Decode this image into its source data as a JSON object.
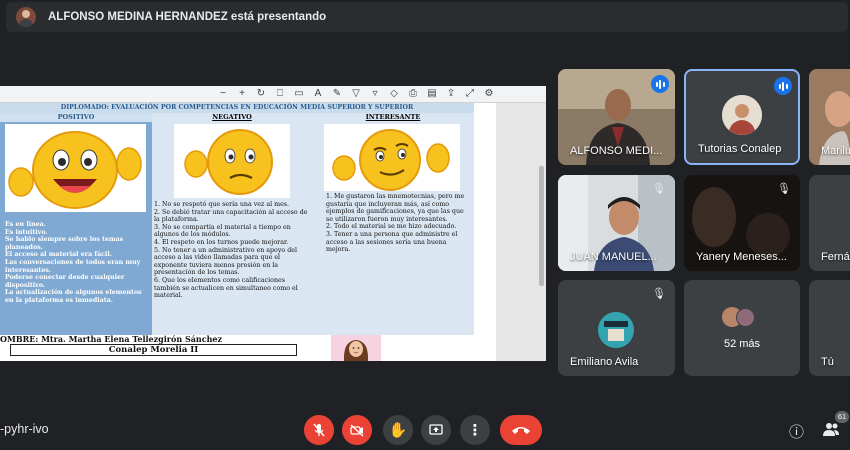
{
  "presenter": {
    "text": "ALFONSO MEDINA HERNANDEZ está presentando"
  },
  "document": {
    "header": "DIPLOMADO: EVALUACIÓN POR COMPETENCIAS EN EDUCACIÓN MEDIA SUPERIOR Y SUPERIOR",
    "columns": {
      "positive": {
        "title": "POSITIVO",
        "items": [
          "Es en línea.",
          "Es intuitivo.",
          "Se hablo siempre sobre los temas planeados.",
          "El acceso al material era fácil.",
          "Las conversaciones de todos eran muy interesantes.",
          "Poderse conectar desde cualquier dispositivo.",
          "La actualización de algunos elementos en la plataforma es inmediata."
        ]
      },
      "negative": {
        "title": "NEGATIVO",
        "items": [
          "1.  No se respetó que sería una vez al mes.",
          "2.  Se debió tratar una capacitación al acceso de la plataforma.",
          "3.  No se compartía el material a tiempo en algunos de los módulos.",
          "4.  El respeto en los turnos puede mejorar.",
          "5.  No tener a un administrativo en apoyo del acceso a las video llamadas para que el exponente tuviera menos presión en la presentación de los temas.",
          "6.  Que los elementos como calificaciones también se actualicen en simultaneo como el material."
        ]
      },
      "interesting": {
        "title": "INTERESANTE",
        "items": [
          "1.  Me gustaron las mnemotecnias, pero me gustaría que incluyeran más, así como ejemplos de gamificaciones, ya que las que se utilizaron fueron muy interesantes.",
          "2.  Todo el material se me hizo adecuado.",
          "3.  Tener a una persona que administre el acceso a las sesiones sería una buena mejora."
        ]
      }
    },
    "name_line": "OMBRE:  Mtra. Martha Elena Tellezgirón Sánchez",
    "school": "Conalep Morelia II"
  },
  "participants": {
    "alfonso": "ALFONSO MEDI...",
    "tutorias": "Tutorias Conalep",
    "marilu": "Marilu",
    "juan": "JUAN MANUEL...",
    "yanery": "Yanery Meneses...",
    "fernanda": "Ferná",
    "emiliano": "Emiliano Avila",
    "more": "52 más",
    "self": "Tú"
  },
  "bottom": {
    "meeting_code": "-pyhr-ivo",
    "participant_count": "61"
  },
  "colors": {
    "background": "#202124",
    "tile": "#3c4043",
    "accent": "#1a73e8",
    "danger": "#ea4335"
  }
}
